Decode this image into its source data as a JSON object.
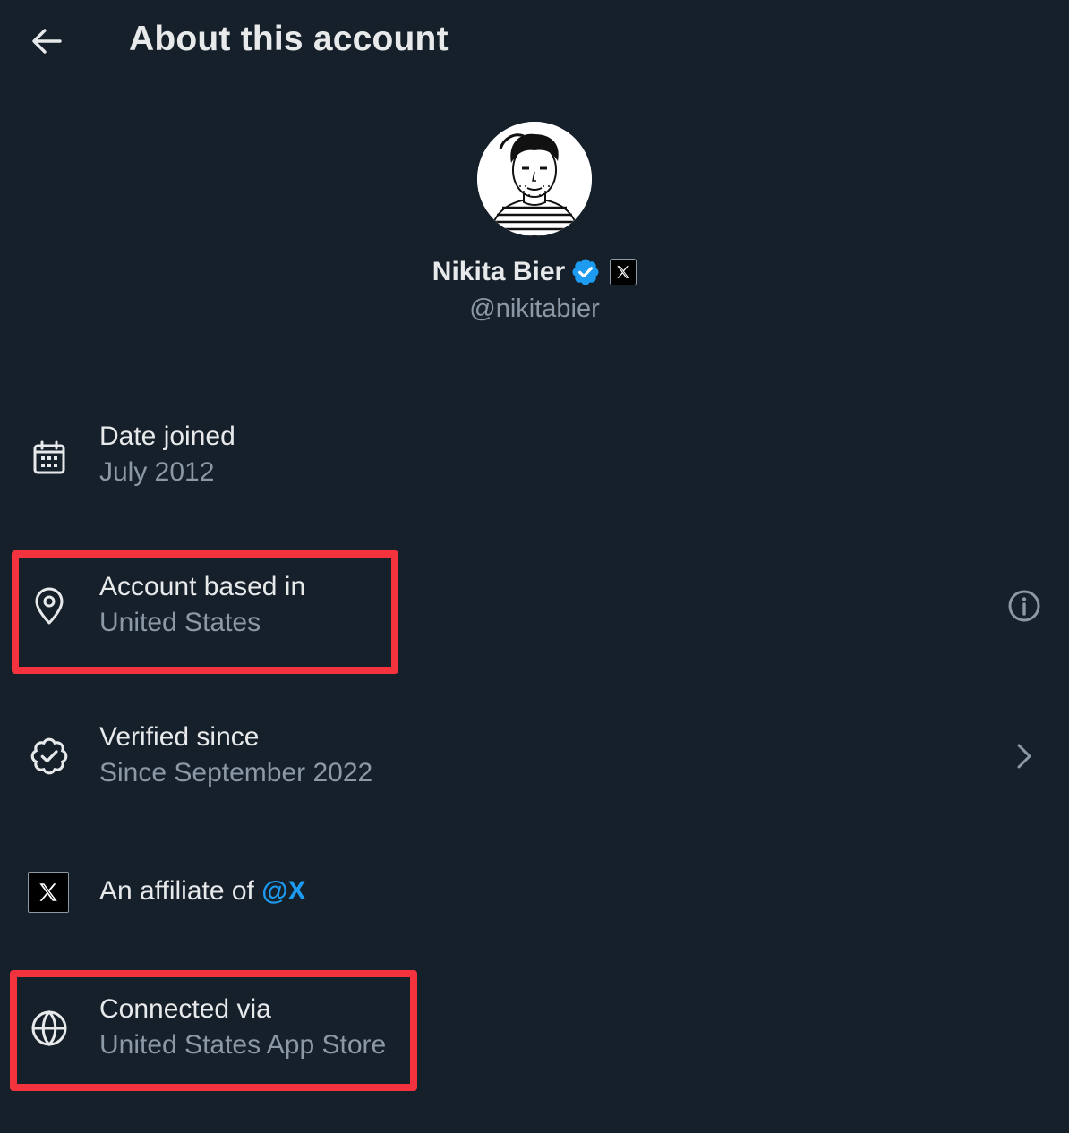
{
  "header": {
    "title": "About this account"
  },
  "profile": {
    "display_name": "Nikita Bier",
    "handle": "@nikitabier"
  },
  "details": {
    "date_joined": {
      "label": "Date joined",
      "value": "July 2012"
    },
    "based_in": {
      "label": "Account based in",
      "value": "United States"
    },
    "verified": {
      "label": "Verified since",
      "value": "Since September 2022"
    },
    "affiliate": {
      "label": "An affiliate of",
      "mention": "@X"
    },
    "connected": {
      "label": "Connected via",
      "value": "United States App Store"
    }
  },
  "colors": {
    "background": "#15202b",
    "primary_text": "#e7e9ea",
    "secondary_text": "#8b98a5",
    "accent": "#1d9bf0",
    "highlight": "#f4333f"
  }
}
